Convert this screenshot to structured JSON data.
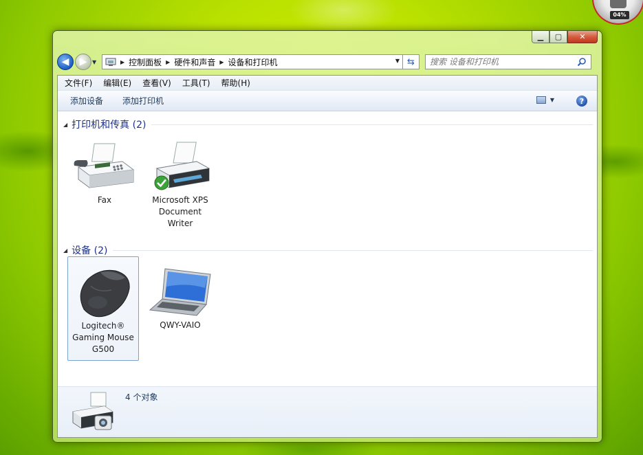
{
  "gadget": {
    "value": "04%"
  },
  "address": {
    "crumbs": [
      "控制面板",
      "硬件和声音",
      "设备和打印机"
    ]
  },
  "search": {
    "placeholder": "搜索 设备和打印机"
  },
  "menu": [
    "文件(F)",
    "编辑(E)",
    "查看(V)",
    "工具(T)",
    "帮助(H)"
  ],
  "commands": {
    "add_device": "添加设备",
    "add_printer": "添加打印机"
  },
  "groups": {
    "printers": {
      "title": "打印机和传真 (2)",
      "items": [
        {
          "label": "Fax",
          "icon": "fax-icon"
        },
        {
          "label": "Microsoft XPS Document Writer",
          "icon": "printer-icon",
          "default": true
        }
      ]
    },
    "devices": {
      "title": "设备 (2)",
      "items": [
        {
          "label": "Logitech® Gaming Mouse G500",
          "icon": "mouse-icon",
          "selected": true
        },
        {
          "label": "QWY-VAIO",
          "icon": "laptop-icon"
        }
      ]
    }
  },
  "details": {
    "count_text": "4 个对象"
  },
  "colors": {
    "group_title": "#1e3287",
    "command_text": "#1e395b",
    "close_button": "#c2381b",
    "desktop": "#b8e000"
  }
}
